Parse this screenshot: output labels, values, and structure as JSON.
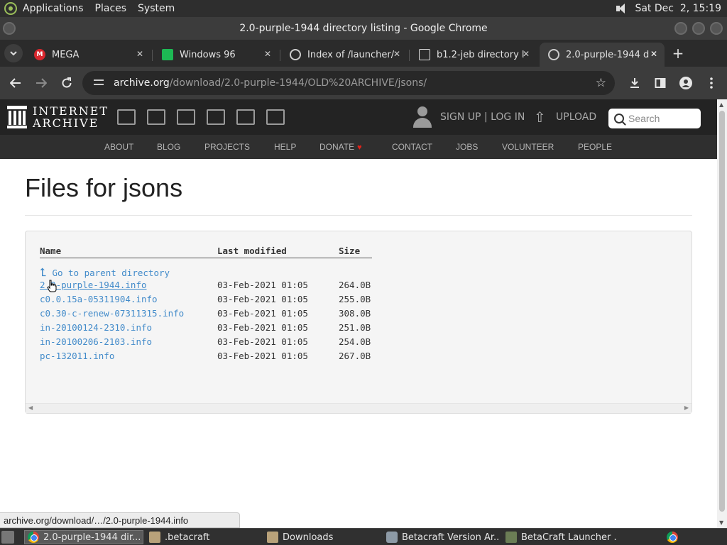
{
  "system_panel": {
    "menus": [
      "Applications",
      "Places",
      "System"
    ],
    "clock": "Sat Dec  2, 15:19"
  },
  "window": {
    "title": "2.0-purple-1944 directory listing - Google Chrome"
  },
  "tabs": [
    {
      "label": "MEGA",
      "icon": "mega-icon"
    },
    {
      "label": "Windows 96",
      "icon": "windows96-icon"
    },
    {
      "label": "Index of /launcher/",
      "icon": "globe-icon"
    },
    {
      "label": "b1.2-jeb directory l",
      "icon": "internet-archive-icon"
    },
    {
      "label": "2.0-purple-1944 d",
      "icon": "globe-icon",
      "active": true
    }
  ],
  "address_bar": {
    "url_host": "archive.org",
    "url_path": "/download/2.0-purple-1944/OLD%20ARCHIVE/jsons/"
  },
  "ia_header": {
    "logo_line1": "INTERNET",
    "logo_line2": "ARCHIVE",
    "signup": "SIGN UP | LOG IN",
    "upload": "UPLOAD",
    "search_placeholder": "Search"
  },
  "ia_nav": [
    "ABOUT",
    "BLOG",
    "PROJECTS",
    "HELP",
    "DONATE",
    "CONTACT",
    "JOBS",
    "VOLUNTEER",
    "PEOPLE"
  ],
  "page": {
    "title": "Files for jsons",
    "columns": {
      "name": "Name",
      "modified": "Last modified",
      "size": "Size"
    },
    "parent_link": "Go to parent directory",
    "files": [
      {
        "name": "2.0-purple-1944.info",
        "modified": "03-Feb-2021 01:05",
        "size": "264.0B"
      },
      {
        "name": "c0.0.15a-05311904.info",
        "modified": "03-Feb-2021 01:05",
        "size": "255.0B"
      },
      {
        "name": "c0.30-c-renew-07311315.info",
        "modified": "03-Feb-2021 01:05",
        "size": "308.0B"
      },
      {
        "name": "in-20100124-2310.info",
        "modified": "03-Feb-2021 01:05",
        "size": "251.0B"
      },
      {
        "name": "in-20100206-2103.info",
        "modified": "03-Feb-2021 01:05",
        "size": "254.0B"
      },
      {
        "name": "pc-132011.info",
        "modified": "03-Feb-2021 01:05",
        "size": "267.0B"
      }
    ]
  },
  "status_bar": {
    "hover_url": "archive.org/download/…/2.0-purple-1944.info"
  },
  "taskbar": [
    {
      "label": "2.0-purple-1944 dir...",
      "icon": "chrome-icon",
      "active": true
    },
    {
      "label": ".betacraft",
      "icon": "folder-icon"
    },
    {
      "label": "Downloads",
      "icon": "folder-icon"
    },
    {
      "label": "Betacraft Version Ar...",
      "icon": "settings-icon"
    },
    {
      "label": "BetaCraft Launcher ...",
      "icon": "game-icon"
    }
  ]
}
